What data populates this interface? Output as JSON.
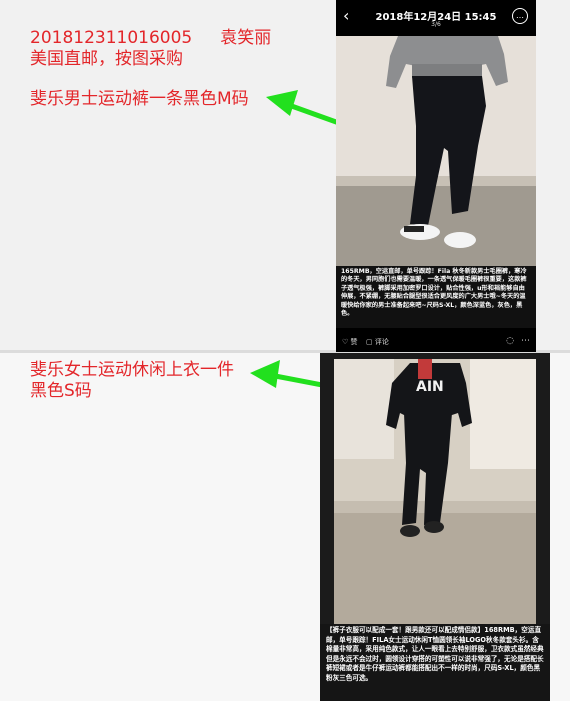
{
  "order": {
    "id": "201812311016005",
    "name": "袁笑丽",
    "shipping": "美国直邮，按图采购"
  },
  "items": [
    {
      "text": "斐乐男士运动裤一条黑色M码"
    },
    {
      "text": "斐乐女士运动休闲上衣一件",
      "text2": "黑色S码"
    }
  ],
  "phone": {
    "back_icon": "‹",
    "title": "2018年12月24日 15:45",
    "page": "3/6",
    "more_icon": "…",
    "caption": "165RMB，空运直邮，单号跟踪！Fila 秋冬新款男士毛圈裤，寒冷的冬天，男同胞们也需要温暖，一条透气保暖毛圈裤很重要，这款裤子透气极强，裤脚采用加密罗口设计，贴合性强，u形和裆能够自由伸展，不紧绷，无腰贴合腿型很适合更风度的广大男士哦~冬天的温暖快给你家的男士准备起来吧~尺码S-XL，颜色深蓝色，灰色，黑色。",
    "like_label": "赞",
    "comment_label": "评论"
  },
  "mirror": {
    "caption": "【裤子衣服可以配成一套！跟男款还可以配成情侣款】168RMB，空运直邮，单号跟踪！FILA女士运动休闲T恤圆领长袖LOGO秋冬款套头衫。含棉量非常高，采用纯色款式，让人一眼看上去特别舒服，卫衣款式虽然经典但是永远不会过时，圆领设计穿搭的可塑性可以说非常强了，无论是搭配长裤短裙或者是牛仔裤运动裤都能搭配出不一样的时尚，尺码S-XL，颜色黑粉灰三色可选。",
    "shirt_text": "AIN"
  },
  "colors": {
    "accent_red": "#e3262a",
    "arrow_green": "#22e01e"
  }
}
